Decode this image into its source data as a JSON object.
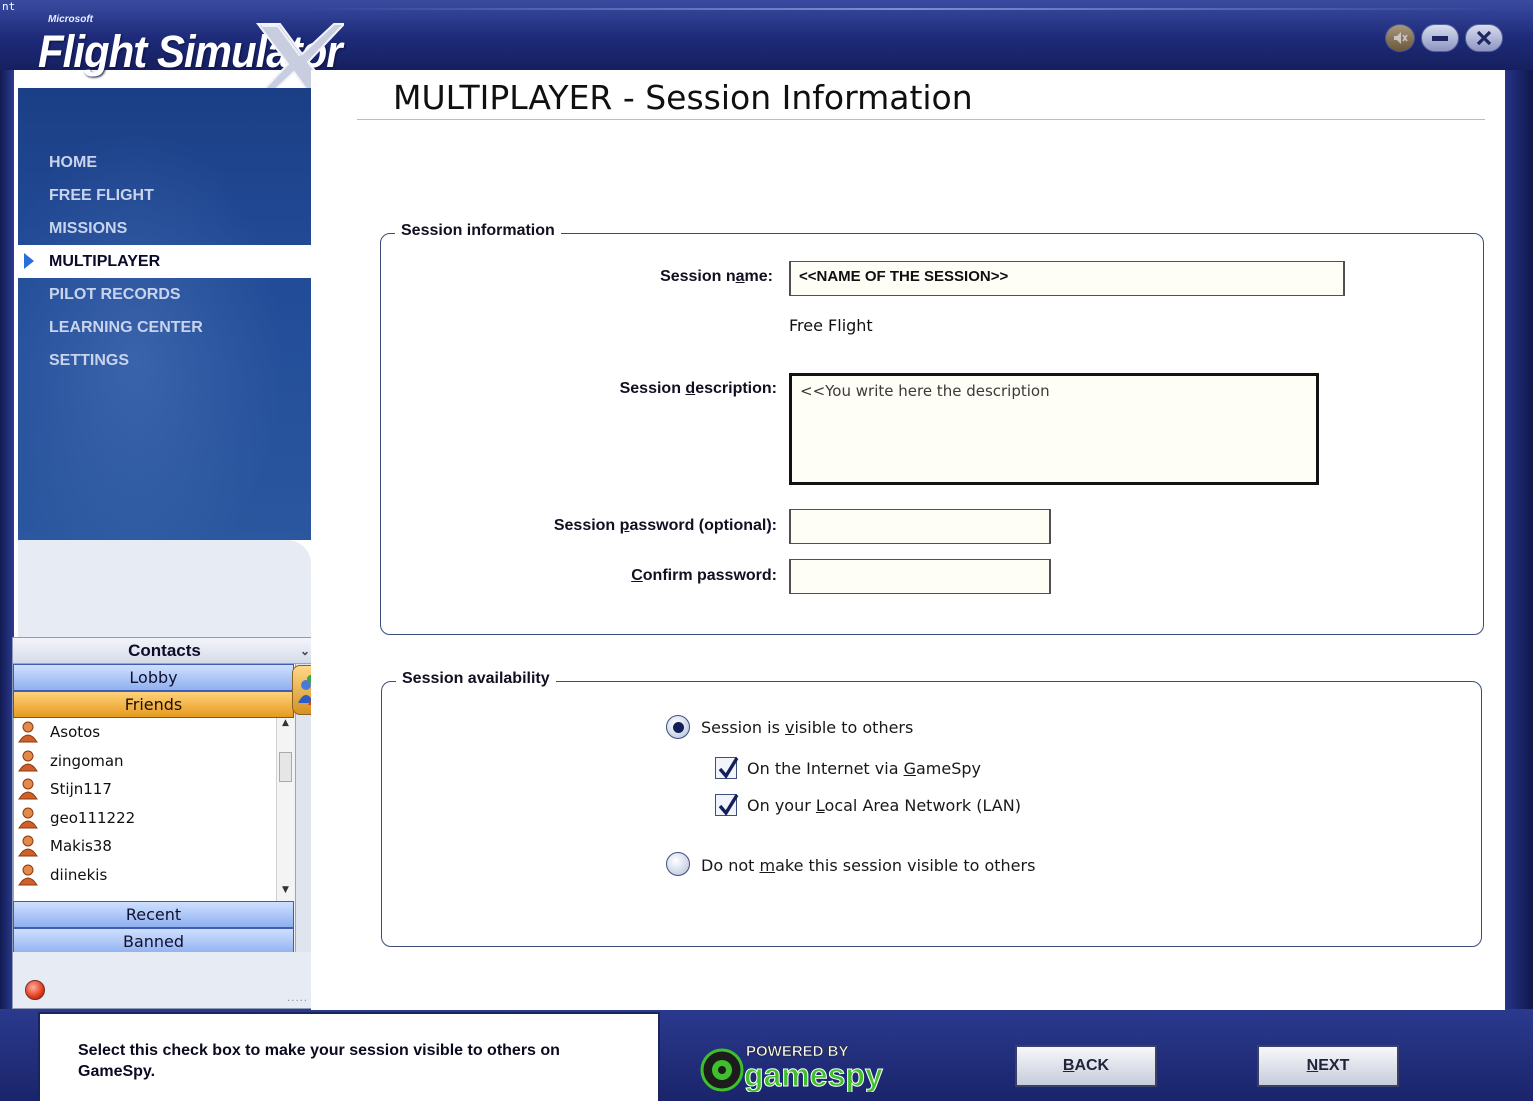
{
  "window": {
    "corner_text": "nt",
    "logo_brand": "Microsoft",
    "logo_title": "Flight Simulator",
    "logo_mark": "X"
  },
  "nav": {
    "items": [
      {
        "label": "HOME",
        "active": false
      },
      {
        "label": "FREE FLIGHT",
        "active": false
      },
      {
        "label": "MISSIONS",
        "active": false
      },
      {
        "label": "MULTIPLAYER",
        "active": true
      },
      {
        "label": "PILOT RECORDS",
        "active": false
      },
      {
        "label": "LEARNING CENTER",
        "active": false
      },
      {
        "label": "SETTINGS",
        "active": false
      }
    ]
  },
  "page": {
    "title": "MULTIPLAYER - Session Information"
  },
  "session_info": {
    "legend": "Session information",
    "name_label_pre": "Session n",
    "name_label_u": "a",
    "name_label_post": "me:",
    "name_value": "<<NAME OF THE SESSION>>",
    "mode_text": "Free Flight",
    "desc_label_pre": "Session ",
    "desc_label_u": "d",
    "desc_label_post": "escription:",
    "desc_value": "<<You write here the description",
    "password_label_pre": "Session ",
    "password_label_u": "p",
    "password_label_post": "assword (optional):",
    "password_value": "",
    "confirm_label_u": "C",
    "confirm_label_post": "onfirm password:",
    "confirm_value": ""
  },
  "availability": {
    "legend": "Session availability",
    "visible_pre": "Session is ",
    "visible_u": "v",
    "visible_post": "isible to others",
    "visible_selected": true,
    "internet_pre": "On the Internet via ",
    "internet_u": "G",
    "internet_post": "ameSpy",
    "internet_checked": true,
    "lan_pre": "On your ",
    "lan_u": "L",
    "lan_post": "ocal Area Network (LAN)",
    "lan_checked": true,
    "hidden_pre": "Do not ",
    "hidden_u": "m",
    "hidden_post": "ake this session visible to others",
    "hidden_selected": false
  },
  "contacts": {
    "title": "Contacts",
    "tabs": {
      "lobby": "Lobby",
      "friends": "Friends",
      "recent": "Recent",
      "banned": "Banned"
    },
    "friends": [
      "Asotos",
      "zingoman",
      "Stijn117",
      "geo111222",
      "Makis38",
      "diinekis"
    ],
    "grip": "....."
  },
  "help": {
    "text": "Select this check box to make your session visible to others on GameSpy."
  },
  "footer": {
    "powered_by": "POWERED BY",
    "gamespy": "gamespy",
    "back_u": "B",
    "back_post": "ACK",
    "next_u": "N",
    "next_post": "EXT"
  },
  "colors": {
    "frame": "#1d2a78",
    "nav_panel": "#224b97",
    "friends_tab": "#e59a1e",
    "lobby_tab": "#8fb0ef",
    "field_bg": "#fffef6"
  },
  "icons": {
    "sound": "mute-sound-icon",
    "minimize": "minimize-icon",
    "close": "close-icon",
    "friend": "person-icon",
    "people": "people-group-icon",
    "status": "online-status-icon"
  }
}
